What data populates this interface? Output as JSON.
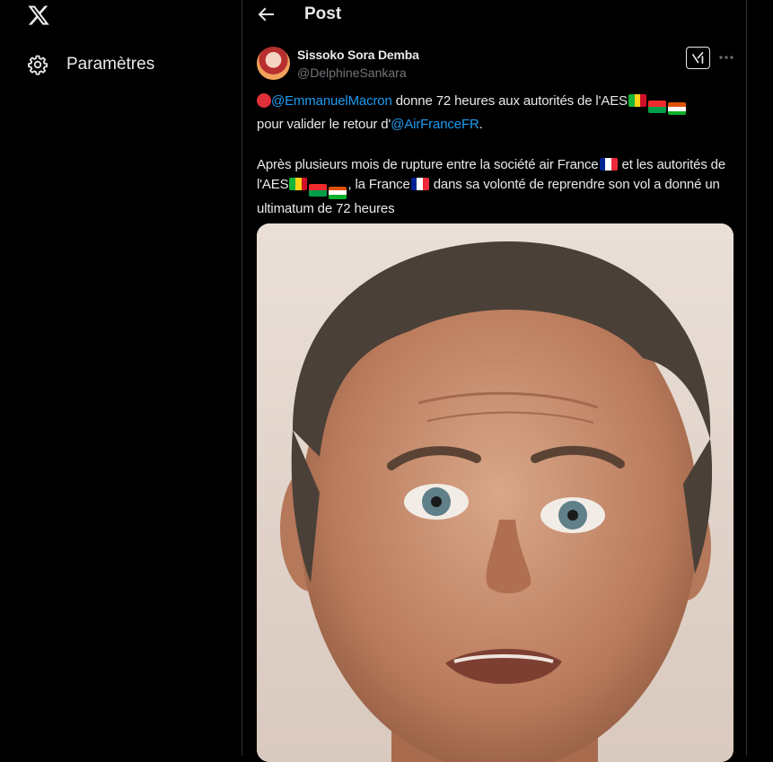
{
  "sidebar": {
    "logo_icon": "x-logo-icon",
    "items": [
      {
        "label": "Paramètres",
        "icon": "gear-icon"
      }
    ]
  },
  "header": {
    "title": "Post",
    "back_icon": "arrow-left-icon"
  },
  "post": {
    "author": {
      "display_name": "Sissoko Sora Demba",
      "handle": "@DelphineSankara"
    },
    "paragraph1": {
      "mention1": "@EmmanuelMacron",
      "text1": " donne 72 heures aux autorités de l'AES",
      "text2": " pour valider le retour d'",
      "mention2": "@AirFranceFR",
      "text3": "."
    },
    "paragraph2": {
      "text1": "Après plusieurs mois de rupture entre la société air France",
      "text2": " et les autorités de l'AES",
      "text3": ", la France",
      "text4": " dans sa volonté de reprendre son vol a donné un ultimatum de 72 heures"
    },
    "media": {
      "type": "photo"
    }
  },
  "colors": {
    "background": "#000000",
    "text": "#e7e9ea",
    "muted": "#71767b",
    "link": "#1d9bf0",
    "border": "#2f3336"
  }
}
